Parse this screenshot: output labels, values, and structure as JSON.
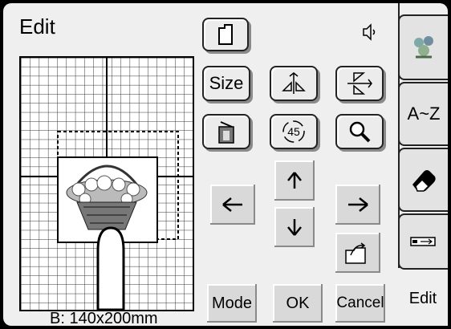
{
  "screen": {
    "title": "Edit",
    "size_readout": "B: 140x200mm"
  },
  "buttons": {
    "size": "Size",
    "rotate_45": "45",
    "mode": "Mode",
    "ok": "OK",
    "cancel": "Cancel"
  },
  "tabs": [
    {
      "name": "tab-embroidery-pattern",
      "icon": "flower-pattern-icon"
    },
    {
      "name": "tab-alphabet",
      "label": "A~Z"
    },
    {
      "name": "tab-eraser",
      "icon": "eraser-icon"
    },
    {
      "name": "tab-usb",
      "icon": "usb-icon"
    },
    {
      "name": "tab-edit",
      "label": "Edit"
    }
  ],
  "icons": {
    "new": "new-document-icon",
    "sound": "speaker-icon",
    "mirror_horizontal": "mirror-horizontal-icon",
    "mirror_vertical": "mirror-vertical-icon",
    "delete": "trash-icon",
    "rotate": "rotate-icon",
    "zoom": "magnifier-icon",
    "arrow_up": "arrow-up-icon",
    "arrow_down": "arrow-down-icon",
    "arrow_left": "arrow-left-icon",
    "arrow_right": "arrow-right-icon",
    "save": "folder-save-icon"
  }
}
